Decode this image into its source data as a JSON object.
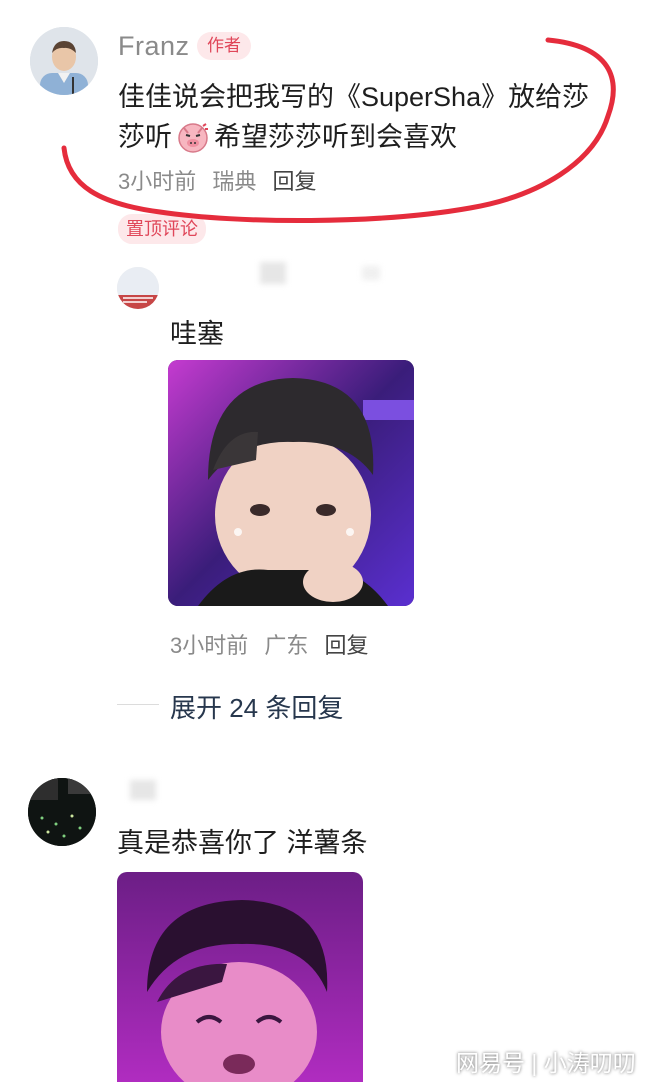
{
  "author_comment": {
    "username": "Franz",
    "badge": "作者",
    "text_line1": "佳佳说会把我写的《SuperSha》放给莎",
    "text_line2a": "莎听",
    "text_line2b": "希望莎莎听到会喜欢",
    "time": "3小时前",
    "location": "瑞典",
    "reply": "回复",
    "pinned_label": "置顶评论",
    "emoji_icon": "pig-angry-emoji-icon",
    "highlight_color": "#e52c3c"
  },
  "reply_comment": {
    "text": "哇塞",
    "time": "3小时前",
    "location": "广东",
    "reply": "回复",
    "expand_label": "展开 24 条回复"
  },
  "second_comment": {
    "text": "真是恭喜你了 洋薯条"
  },
  "watermark": {
    "label": "网易号 | 小涛叨叨"
  }
}
